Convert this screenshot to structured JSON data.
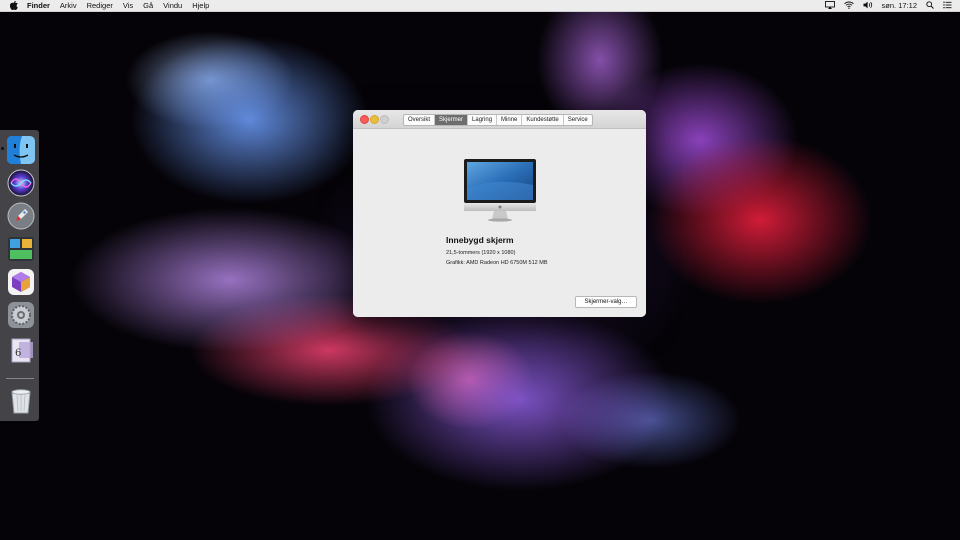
{
  "menubar": {
    "app_name": "Finder",
    "items": [
      "Arkiv",
      "Rediger",
      "Vis",
      "Gå",
      "Vindu",
      "Hjelp"
    ],
    "clock": "søn. 17:12",
    "status_icons": [
      "airplay-icon",
      "wifi-icon",
      "volume-icon",
      "spotlight-icon",
      "notification-center-icon"
    ]
  },
  "dock": {
    "items": [
      {
        "name": "finder",
        "icon": "finder-icon",
        "running": true
      },
      {
        "name": "siri",
        "icon": "siri-icon",
        "running": false
      },
      {
        "name": "launchpad",
        "icon": "launchpad-icon",
        "running": false
      },
      {
        "name": "mission-control",
        "icon": "mission-control-icon",
        "running": false
      },
      {
        "name": "app",
        "icon": "app-icon",
        "running": false
      },
      {
        "name": "system-preferences",
        "icon": "gear-icon",
        "running": false
      },
      {
        "name": "document",
        "icon": "document-icon",
        "running": false
      },
      {
        "name": "trash",
        "icon": "trash-icon",
        "running": false
      }
    ]
  },
  "window": {
    "tabs": [
      "Oversikt",
      "Skjermer",
      "Lagring",
      "Minne",
      "Kundestøtte",
      "Service"
    ],
    "active_tab": "Skjermer",
    "display": {
      "title": "Innebygd skjerm",
      "size": "21,5-tommers (1920 x 1080)",
      "graphics": "Grafikk: AMD Radeon HD 6750M 512 MB"
    },
    "button_label": "Skjermer-valg…"
  },
  "colors": {
    "close": "#fc5b57",
    "minimize": "#e5bf3c",
    "active_tab": "#6d6d6d",
    "window_bg": "#ececec"
  }
}
